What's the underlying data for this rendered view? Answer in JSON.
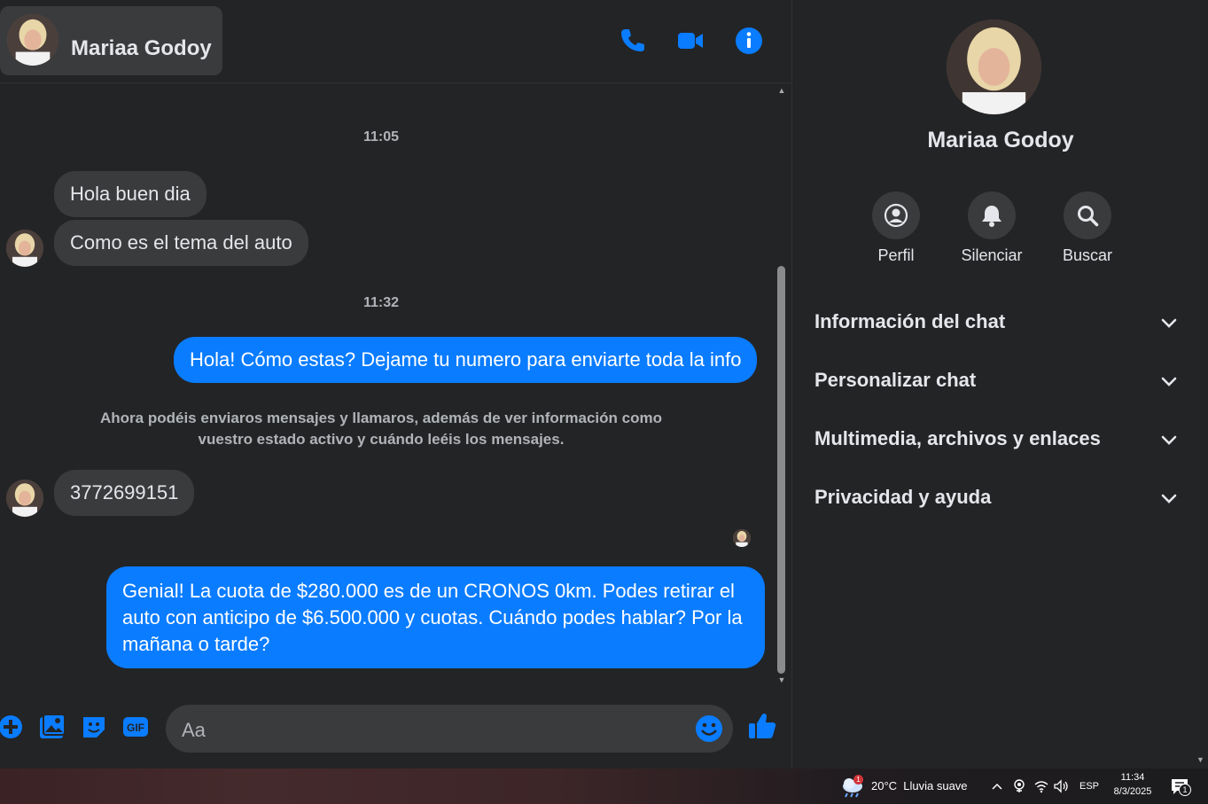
{
  "header": {
    "contact_name": "Mariaa Godoy",
    "icons": [
      "phone-icon",
      "video-camera-icon",
      "info-icon"
    ]
  },
  "messages": {
    "time_1": "11:05",
    "in_1": "Hola buen dia",
    "in_2": "Como es el tema del auto",
    "time_2": "11:32",
    "out_1": "Hola! Cómo estas? Dejame tu numero para enviarte toda la info",
    "notice_line1": "Ahora podéis enviaros mensajes y llamaros, además de ver información como",
    "notice_line2": "vuestro estado activo y cuándo leéis los mensajes.",
    "in_3": "3772699151",
    "out_2": "Genial! La cuota de $280.000 es de un CRONOS 0km. Podes retirar el auto con anticipo de $6.500.000 y cuotas. Cuándo podes hablar? Por la mañana o tarde?"
  },
  "composer": {
    "placeholder": "Aa"
  },
  "sidebar": {
    "name": "Mariaa Godoy",
    "actions": [
      {
        "label": "Perfil",
        "icon": "user-circle-icon"
      },
      {
        "label": "Silenciar",
        "icon": "bell-icon"
      },
      {
        "label": "Buscar",
        "icon": "search-icon"
      }
    ],
    "sections": [
      {
        "label": "Información del chat"
      },
      {
        "label": "Personalizar chat"
      },
      {
        "label": "Multimedia, archivos y enlaces"
      },
      {
        "label": "Privacidad y ayuda"
      }
    ]
  },
  "taskbar": {
    "weather_badge": "1",
    "weather": "20°C  Lluvia suave",
    "language": "ESP",
    "time": "11:34",
    "date": "8/3/2025",
    "notification_count": "1"
  },
  "colors": {
    "accent": "#0a7cff",
    "background": "#232425",
    "bubble_in": "#3a3b3c"
  }
}
